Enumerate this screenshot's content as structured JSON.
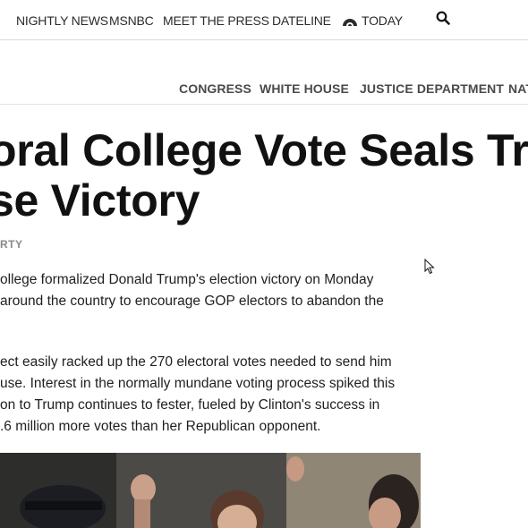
{
  "top_nav": {
    "items": [
      "NIGHTLY NEWS",
      "MSNBC",
      "MEET THE PRESS",
      "DATELINE",
      "TODAY"
    ]
  },
  "section_nav": {
    "items": [
      "CONGRESS",
      "WHITE HOUSE",
      "JUSTICE DEPARTMENT",
      "NAT"
    ]
  },
  "article": {
    "headline_lines": [
      "oral College Vote Seals Tr",
      "se Victory"
    ],
    "byline": "RTY",
    "paragraph1": [
      "ollege formalized Donald Trump's election victory on Monday",
      " around the country to encourage GOP electors to abandon the"
    ],
    "paragraph2": [
      "ect easily racked up the 270 electoral votes needed to send him",
      "use. Interest in the normally mundane voting process spiked this",
      "on to Trump continues to fester, fueled by Clinton's success in",
      ".6 million more votes than her Republican opponent."
    ]
  },
  "colors": {
    "text": "#1a1a1a",
    "nav_text": "#2b2b2b",
    "section_text": "#4a4a4a",
    "byline": "#8a8a8a"
  },
  "icons": [
    "today-sun-icon",
    "search-icon",
    "mouse-cursor-icon"
  ]
}
